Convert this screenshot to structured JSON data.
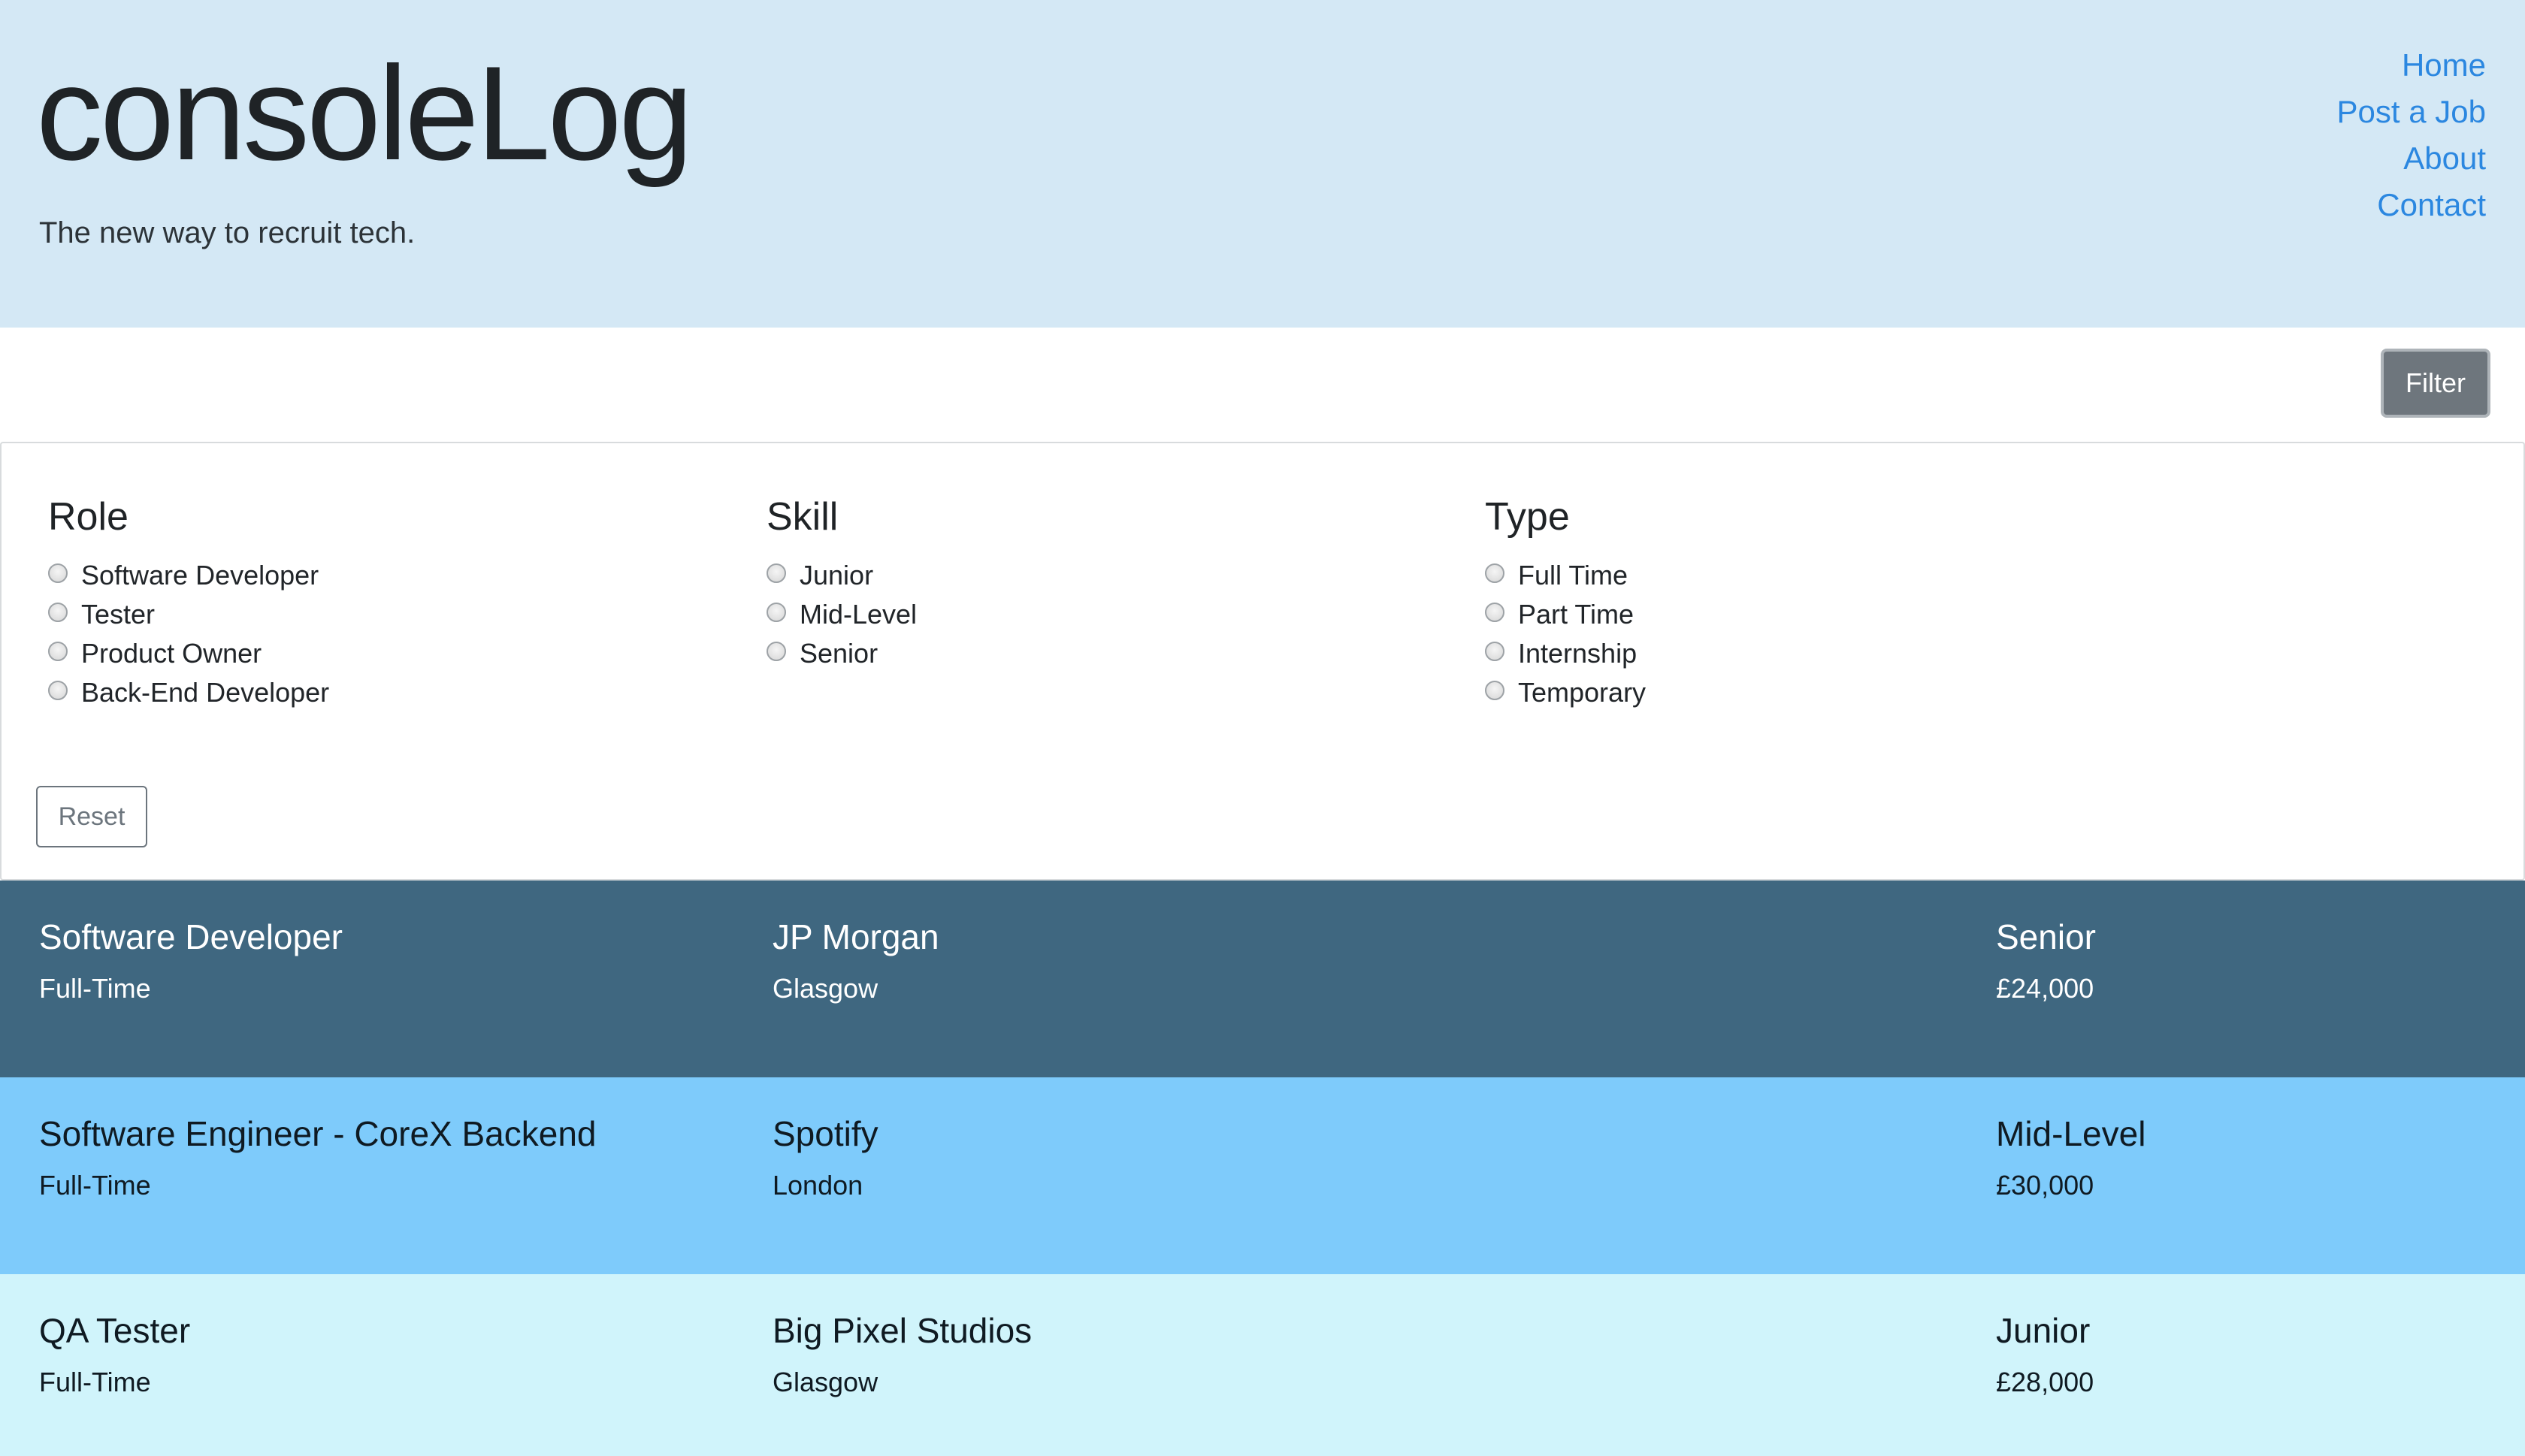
{
  "header": {
    "brand": "consoleLog",
    "tagline": "The new way to recruit tech.",
    "nav": [
      "Home",
      "Post a Job",
      "About",
      "Contact"
    ]
  },
  "filter_button": "Filter",
  "filters": {
    "role": {
      "heading": "Role",
      "options": [
        "Software Developer",
        "Tester",
        "Product Owner",
        "Back-End Developer"
      ]
    },
    "skill": {
      "heading": "Skill",
      "options": [
        "Junior",
        "Mid-Level",
        "Senior"
      ]
    },
    "type": {
      "heading": "Type",
      "options": [
        "Full Time",
        "Part Time",
        "Internship",
        "Temporary"
      ]
    },
    "reset_label": "Reset"
  },
  "jobs": [
    {
      "title": "Software Developer",
      "type": "Full-Time",
      "company": "JP Morgan",
      "location": "Glasgow",
      "level": "Senior",
      "salary": "£24,000",
      "bg": "#3f6780",
      "fg": "#ffffff"
    },
    {
      "title": "Software Engineer - CoreX Backend",
      "type": "Full-Time",
      "company": "Spotify",
      "location": "London",
      "level": "Mid-Level",
      "salary": "£30,000",
      "bg": "#7ecbfb",
      "fg": "#0f1a22"
    },
    {
      "title": "QA Tester",
      "type": "Full-Time",
      "company": "Big Pixel Studios",
      "location": "Glasgow",
      "level": "Junior",
      "salary": "£28,000",
      "bg": "#d0f4fb",
      "fg": "#0f1a22"
    }
  ]
}
